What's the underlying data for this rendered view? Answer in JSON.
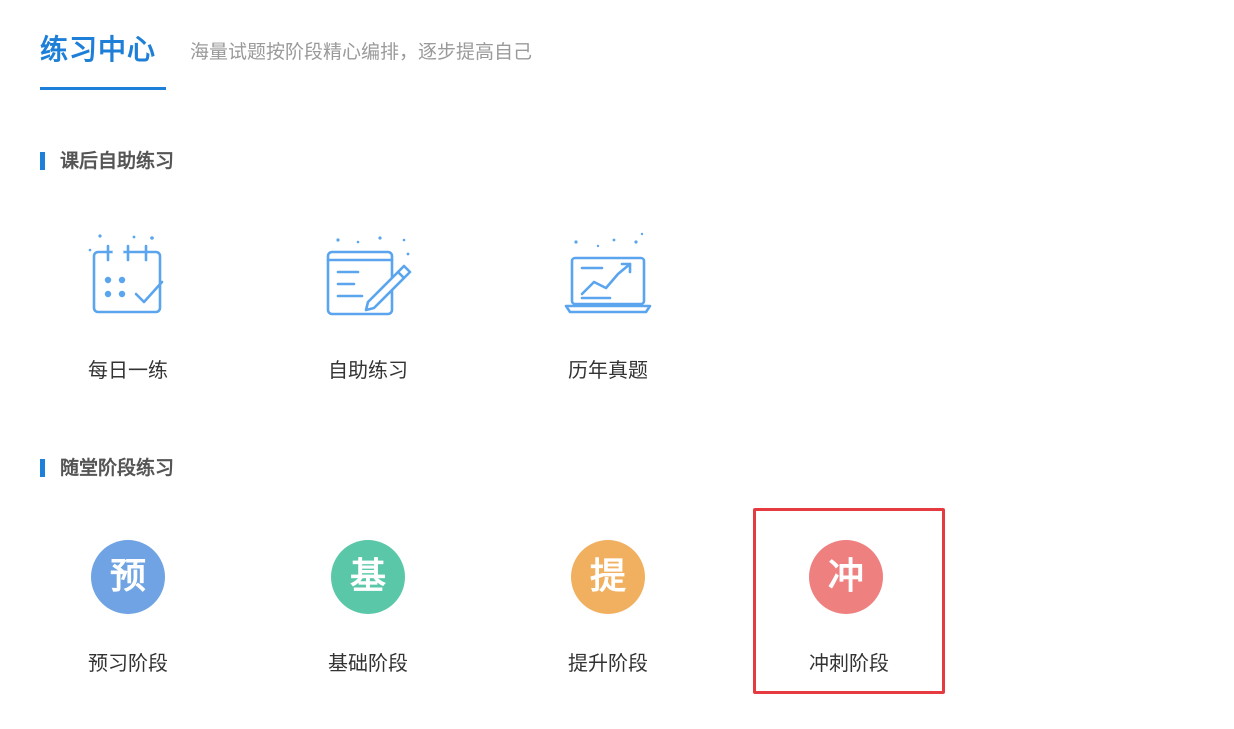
{
  "header": {
    "title": "练习中心",
    "subtitle": "海量试题按阶段精心编排，逐步提高自己"
  },
  "sections": [
    {
      "title": "课后自助练习",
      "items": [
        {
          "label": "每日一练",
          "icon": "calendar-check-icon"
        },
        {
          "label": "自助练习",
          "icon": "document-pen-icon"
        },
        {
          "label": "历年真题",
          "icon": "laptop-chart-icon"
        }
      ]
    },
    {
      "title": "随堂阶段练习",
      "items": [
        {
          "label": "预习阶段",
          "badge": "预",
          "color": "#6fa3e3"
        },
        {
          "label": "基础阶段",
          "badge": "基",
          "color": "#5ac8a8"
        },
        {
          "label": "提升阶段",
          "badge": "提",
          "color": "#f0b05f"
        },
        {
          "label": "冲刺阶段",
          "badge": "冲",
          "color": "#ef8080"
        }
      ]
    }
  ],
  "colors": {
    "accent": "#1e7fd8",
    "icon_line": "#5aa5ee",
    "highlight_border": "#e53b40"
  }
}
